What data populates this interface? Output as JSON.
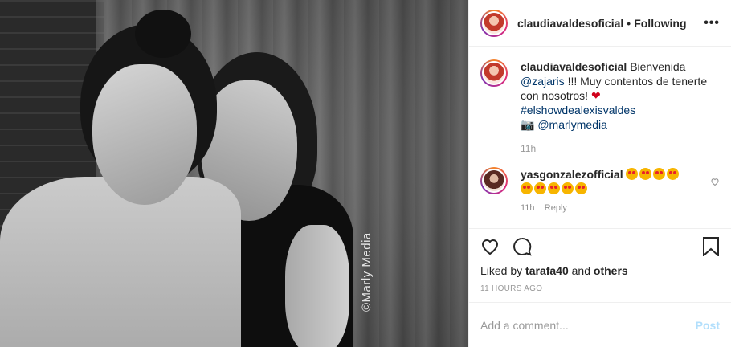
{
  "header": {
    "username": "claudiavaldesoficial",
    "separator": "•",
    "follow_status": "Following",
    "more": "•••"
  },
  "photo": {
    "watermark": "©Marly Media"
  },
  "caption": {
    "username": "claudiavaldesoficial",
    "text1": "Bienvenida",
    "mention1": "@zajaris",
    "text2": "!!! Muy contentos de tenerte con nosotros!",
    "heart": "❤",
    "hashtag": "#elshowdealexisvaldes",
    "camera": "📷",
    "mention2": "@marlymedia",
    "age": "11h"
  },
  "comment": {
    "username": "yasgonzalezofficial",
    "emoji_count": 9,
    "age": "11h",
    "reply": "Reply"
  },
  "likes": {
    "prefix": "Liked by",
    "user": "tarafa40",
    "joiner": "and",
    "others": "others"
  },
  "timestamp": "11 HOURS AGO",
  "add_comment": {
    "placeholder": "Add a comment...",
    "post_label": "Post"
  },
  "colors": {
    "link": "#003569",
    "post_disabled": "#b2dffc",
    "muted": "#999999"
  }
}
